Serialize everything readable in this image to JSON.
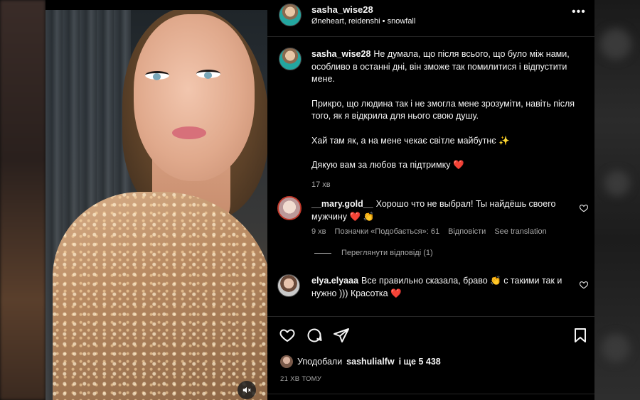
{
  "post": {
    "author": "sasha_wise28",
    "audio": "Øneheart, reidenshi • snowfall",
    "caption": {
      "username": "sasha_wise28",
      "paragraphs": [
        "Не думала, що після всього, що було між нами, особливо в останні дні, він зможе так помилитися і відпустити мене.",
        "Прикро, що людина так і не змогла мене зрозуміти, навіть після того, як я відкрила для нього свою душу.",
        "Хай там як, а на мене чекає світле майбутнє ✨",
        "Дякую вам за любов та підтримку ❤️"
      ],
      "time": "17 хв"
    }
  },
  "comments": [
    {
      "username": "__mary.gold__",
      "text": "Хорошо что не выбрал! Ты найдёшь своего мужчину ❤️ 👏",
      "time": "9 хв",
      "likes": "Позначки «Подобається»: 61",
      "reply": "Відповісти",
      "translate": "See translation"
    },
    {
      "username": "elya.elyaaa",
      "text": "Все правильно сказала, браво 👏 с такими так и нужно ))) Красотка ❤️"
    }
  ],
  "view_replies": "Переглянути відповіді (1)",
  "liked_by": {
    "prefix": "Уподобали",
    "user": "sashulialfw",
    "rest": "і ще 5 438"
  },
  "timestamp": "21 ХВ ТОМУ",
  "icons": {
    "more": "more-horizontal-icon",
    "like": "heart-icon",
    "comment": "comment-icon",
    "share": "send-icon",
    "save": "bookmark-icon",
    "mute": "speaker-muted-icon"
  }
}
